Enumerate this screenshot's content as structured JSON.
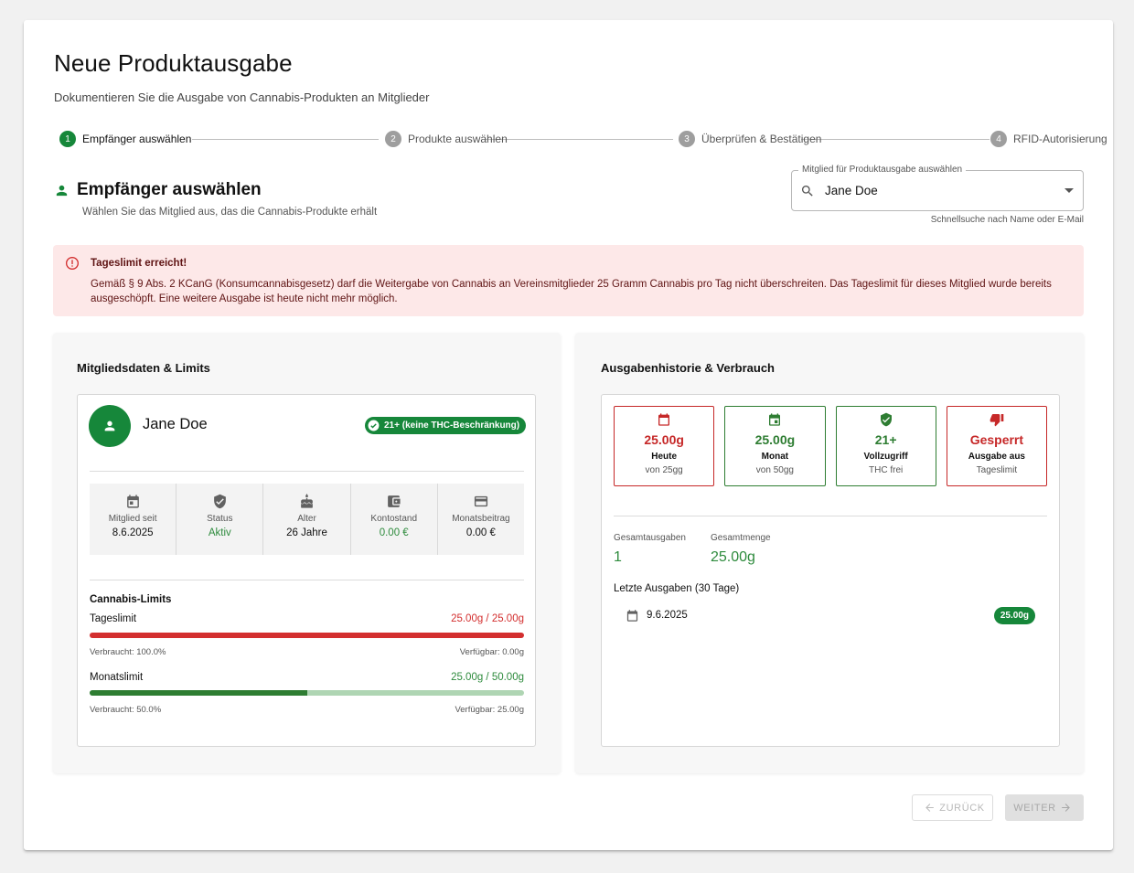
{
  "header": {
    "title": "Neue Produktausgabe",
    "subtitle": "Dokumentieren Sie die Ausgabe von Cannabis-Produkten an Mitglieder"
  },
  "stepper": {
    "steps": [
      {
        "number": "1",
        "label": "Empfänger auswählen",
        "active": true
      },
      {
        "number": "2",
        "label": "Produkte auswählen",
        "active": false
      },
      {
        "number": "3",
        "label": "Überprüfen & Bestätigen",
        "active": false
      },
      {
        "number": "4",
        "label": "RFID-Autorisierung",
        "active": false
      }
    ]
  },
  "section": {
    "title": "Empfänger auswählen",
    "subtitle": "Wählen Sie das Mitglied aus, das die Cannabis-Produkte erhält"
  },
  "member_select": {
    "label": "Mitglied für Produktausgabe auswählen",
    "value": "Jane Doe",
    "helper": "Schnellsuche nach Name oder E-Mail"
  },
  "alert": {
    "title": "Tageslimit erreicht!",
    "text": "Gemäß § 9 Abs. 2 KCanG (Konsumcannabisgesetz) darf die Weitergabe von Cannabis an Vereinsmitglieder 25 Gramm Cannabis pro Tag nicht überschreiten. Das Tageslimit für dieses Mitglied wurde bereits ausgeschöpft. Eine weitere Ausgabe ist heute nicht mehr möglich."
  },
  "member_panel": {
    "title": "Mitgliedsdaten & Limits",
    "name": "Jane Doe",
    "age_badge": "21+ (keine THC-Beschränkung)",
    "stats": [
      {
        "icon": "calendar-icon",
        "label": "Mitglied seit",
        "value": "8.6.2025"
      },
      {
        "icon": "shield-icon",
        "label": "Status",
        "value": "Aktiv"
      },
      {
        "icon": "cake-icon",
        "label": "Alter",
        "value": "26 Jahre"
      },
      {
        "icon": "wallet-icon",
        "label": "Kontostand",
        "value": "0.00 €"
      },
      {
        "icon": "credit-card-icon",
        "label": "Monatsbeitrag",
        "value": "0.00 €"
      }
    ],
    "limits_title": "Cannabis-Limits",
    "daily": {
      "name": "Tageslimit",
      "value": "25.00g / 25.00g",
      "used_fraction": 1.0,
      "used_text": "Verbraucht: 100.0%",
      "available_text": "Verfügbar: 0.00g"
    },
    "monthly": {
      "name": "Monatslimit",
      "value": "25.00g / 50.00g",
      "used_fraction": 0.5,
      "used_text": "Verbraucht: 50.0%",
      "available_text": "Verfügbar: 25.00g"
    }
  },
  "history_panel": {
    "title": "Ausgabenhistorie & Verbrauch",
    "tiles": [
      {
        "icon": "calendar-icon",
        "value": "25.00g",
        "label": "Heute",
        "sub": "von 25gg",
        "tone": "red"
      },
      {
        "icon": "calendar-month-icon",
        "value": "25.00g",
        "label": "Monat",
        "sub": "von 50gg",
        "tone": "green"
      },
      {
        "icon": "shield-check-icon",
        "value": "21+",
        "label": "Vollzugriff",
        "sub": "THC frei",
        "tone": "green"
      },
      {
        "icon": "thumb-down-icon",
        "value": "Gesperrt",
        "label": "Ausgabe aus",
        "sub": "Tageslimit",
        "tone": "red"
      }
    ],
    "total_count_label": "Gesamtausgaben",
    "total_count": "1",
    "total_amount_label": "Gesamtmenge",
    "total_amount": "25.00g",
    "recent_title": "Letzte Ausgaben (30 Tage)",
    "recent": [
      {
        "date": "9.6.2025",
        "amount": "25.00g"
      }
    ]
  },
  "actions": {
    "back": "ZURÜCK",
    "next": "WEITER"
  },
  "colors": {
    "brand_green": "#16873a",
    "limit_red": "#d32f2f",
    "alert_bg": "#fde8e8"
  }
}
